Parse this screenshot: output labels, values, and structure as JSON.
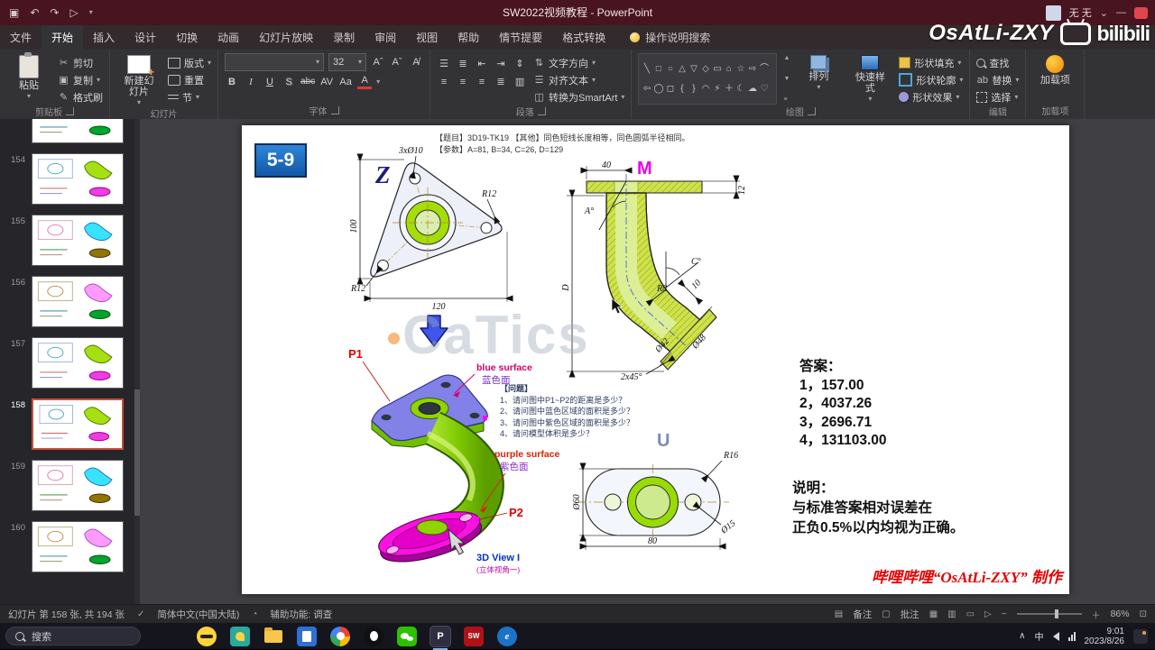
{
  "titlebar": {
    "title": "SW2022视频教程  -  PowerPoint",
    "user": "无 无",
    "watermark_name": "OsAtLi-ZXY",
    "watermark_brand": "bilibili"
  },
  "ribbon": {
    "tabs": [
      "文件",
      "开始",
      "插入",
      "设计",
      "切换",
      "动画",
      "幻灯片放映",
      "录制",
      "审阅",
      "视图",
      "帮助",
      "情节提要",
      "格式转换"
    ],
    "tell_me": "操作说明搜索",
    "font_size": "32",
    "groups": {
      "clipboard": {
        "label": "剪贴板",
        "paste": "粘贴",
        "cut": "剪切",
        "copy": "复制",
        "painter": "格式刷"
      },
      "slides": {
        "label": "幻灯片",
        "new_slide": "新建幻灯片",
        "layout": "版式",
        "reset": "重置",
        "section": "节"
      },
      "font": {
        "label": "字体"
      },
      "paragraph": {
        "label": "段落",
        "direction": "文字方向",
        "align": "对齐文本",
        "smartart": "转换为SmartArt"
      },
      "drawing": {
        "label": "绘图",
        "arrange": "排列",
        "styles": "快速样式",
        "fill": "形状填充",
        "outline": "形状轮廓",
        "effects": "形状效果"
      },
      "editing": {
        "label": "编辑",
        "find": "查找",
        "replace": "替换",
        "select": "选择"
      },
      "addins": {
        "label": "加载项",
        "button": "加载项"
      }
    }
  },
  "thumbs": [
    {
      "num": "154"
    },
    {
      "num": "155"
    },
    {
      "num": "156"
    },
    {
      "num": "157"
    },
    {
      "num": "158"
    },
    {
      "num": "159"
    },
    {
      "num": "160"
    }
  ],
  "slide": {
    "badge": "5-9",
    "header1": "【题目】3D19-TK19   【其他】同色短线长度相等，同色圆弧半径相同。",
    "header2": "【参数】A=81, B=34, C=26, D=129",
    "z": {
      "label": "Z",
      "holes": "3xØ10",
      "r_top": "R12",
      "h": "100",
      "r_bl": "R12",
      "w": "120"
    },
    "m": {
      "label": "M",
      "d40": "40",
      "d12": "12",
      "a": "A°",
      "d": "D",
      "c": "C°",
      "r8": "R8",
      "d10": "10",
      "d42": "Ø42",
      "d48": "Ø48",
      "chamfer": "2x45°"
    },
    "u": {
      "label": "U",
      "d60": "Ø60",
      "r16": "R16",
      "d15": "Ø15",
      "d80": "80"
    },
    "iso": {
      "p1": "P1",
      "p2": "P2",
      "blue_en": "blue surface",
      "blue_cn": "蓝色面",
      "purple_en": "purple surface",
      "purple_cn": "紫色面",
      "view": "3D View I",
      "view_cn": "(立体视角一)"
    },
    "questions": {
      "title": "【问题】",
      "q1": "1、请问图中P1~P2的距离是多少？",
      "q2": "2、请问图中蓝色区域的面积是多少？",
      "q3": "3、请问图中紫色区域的面积是多少？",
      "q4": "4、请问模型体积是多少？"
    },
    "answers": {
      "title": "答案：",
      "a1": "1，157.00",
      "a2": "2，4037.26",
      "a3": "3，2696.71",
      "a4": "4，131103.00"
    },
    "note": {
      "title": "说明：",
      "l1": "与标准答案相对误差在",
      "l2": "正负0.5%以内均视为正确。"
    },
    "credit": "哔哩哔哩“OsAtLi-ZXY” 制作",
    "watermark": "CaTics"
  },
  "statusbar": {
    "slide_info": "幻灯片 第 158 张, 共 194 张",
    "language": "简体中文(中国大陆)",
    "accessibility": "辅助功能: 调查",
    "notes": "备注",
    "comments": "批注",
    "zoom": "86%"
  },
  "taskbar": {
    "search": "搜索",
    "ime": "中",
    "time": "9:01",
    "date": "2023/8/26"
  }
}
